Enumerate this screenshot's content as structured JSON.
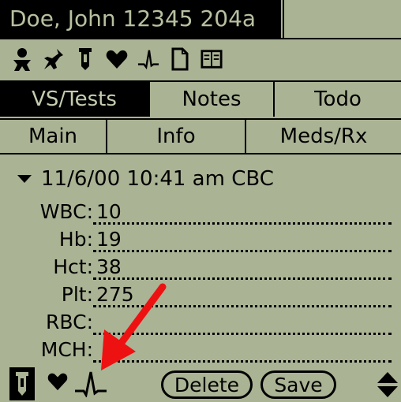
{
  "title": "Doe, John 12345 204a",
  "icons": [
    "person-icon",
    "pin-icon",
    "test-tube-icon",
    "heart-icon",
    "ecg-wave-icon",
    "document-icon",
    "book-icon"
  ],
  "tabs_row1": [
    {
      "label": "VS/Tests",
      "active": true
    },
    {
      "label": "Notes",
      "active": false
    },
    {
      "label": "Todo",
      "active": false
    }
  ],
  "tabs_row2": [
    {
      "label": "Main"
    },
    {
      "label": "Info"
    },
    {
      "label": "Meds/Rx"
    }
  ],
  "entry": {
    "header": "11/6/00 10:41 am CBC",
    "fields": [
      {
        "label": "WBC:",
        "value": "10"
      },
      {
        "label": "Hb:",
        "value": "19"
      },
      {
        "label": "Hct:",
        "value": "38"
      },
      {
        "label": "Plt:",
        "value": "275"
      },
      {
        "label": "RBC:",
        "value": ""
      },
      {
        "label": "MCH:",
        "value": ""
      }
    ]
  },
  "toolbar": {
    "delete_label": "Delete",
    "save_label": "Save"
  },
  "colors": {
    "screen_bg": "#aab394",
    "ink": "#000000",
    "annotation_arrow": "#ee1111"
  }
}
